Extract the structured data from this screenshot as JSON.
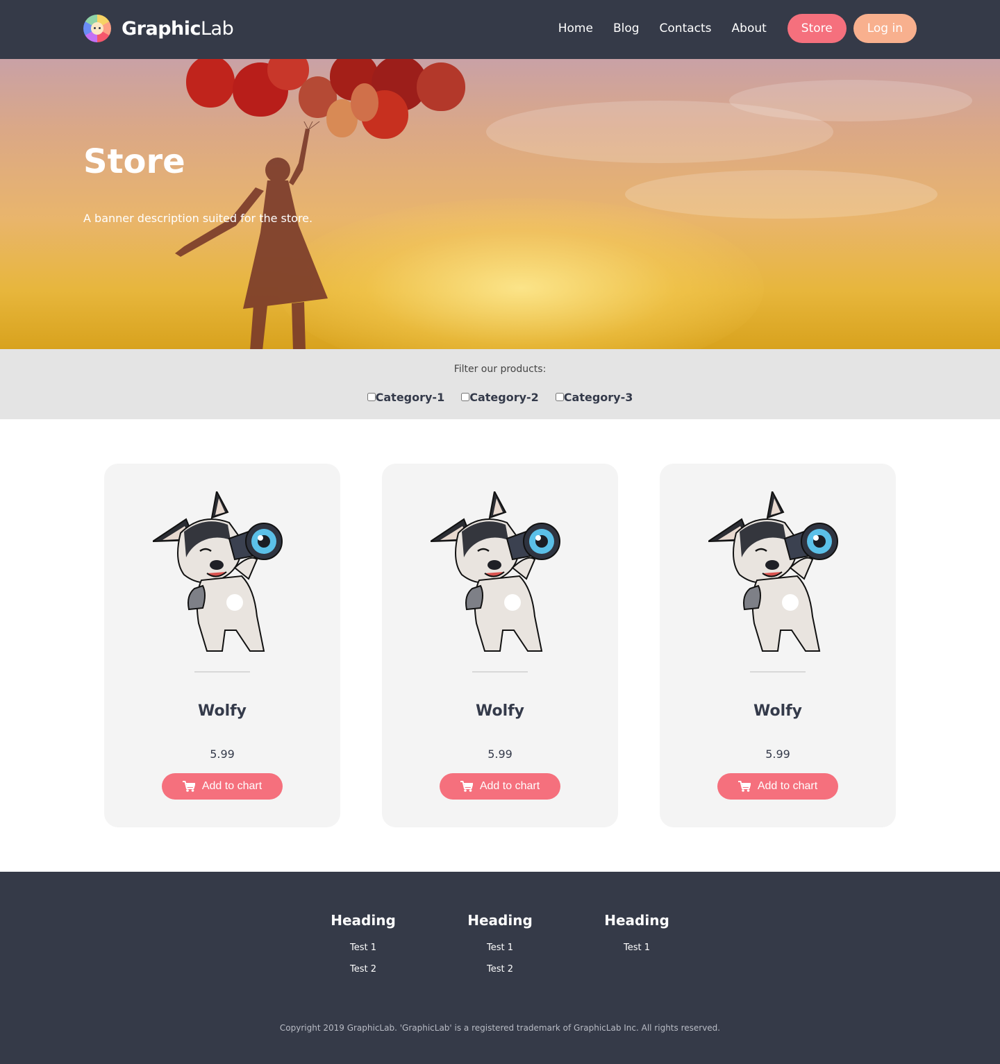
{
  "header": {
    "logo_bold": "Graphic",
    "logo_light": "Lab",
    "nav": [
      "Home",
      "Blog",
      "Contacts",
      "About"
    ],
    "store_button": "Store",
    "login_button": "Log in"
  },
  "banner": {
    "title": "Store",
    "description": "A banner description suited for the store."
  },
  "filter": {
    "label": "Filter our products:",
    "categories": [
      "Category-1",
      "Category-2",
      "Category-3"
    ]
  },
  "products": [
    {
      "name": "Wolfy",
      "price": "5.99",
      "button": "Add to chart"
    },
    {
      "name": "Wolfy",
      "price": "5.99",
      "button": "Add to chart"
    },
    {
      "name": "Wolfy",
      "price": "5.99",
      "button": "Add to chart"
    }
  ],
  "footer": {
    "columns": [
      {
        "heading": "Heading",
        "links": [
          "Test 1",
          "Test 2"
        ]
      },
      {
        "heading": "Heading",
        "links": [
          "Test 1",
          "Test 2"
        ]
      },
      {
        "heading": "Heading",
        "links": [
          "Test 1"
        ]
      }
    ],
    "copyright": "Copyright 2019 GraphicLab. 'GraphicLab' is a registered trademark of GraphicLab Inc. All rights reserved."
  },
  "icons": {
    "logo": "logo-palette-icon",
    "cart": "shopping-cart-icon"
  },
  "colors": {
    "header_bg": "#353a48",
    "accent_pink": "#f5707d",
    "accent_peach": "#f8b08e",
    "filter_bg": "#e4e4e4",
    "card_bg": "#f4f4f4"
  }
}
